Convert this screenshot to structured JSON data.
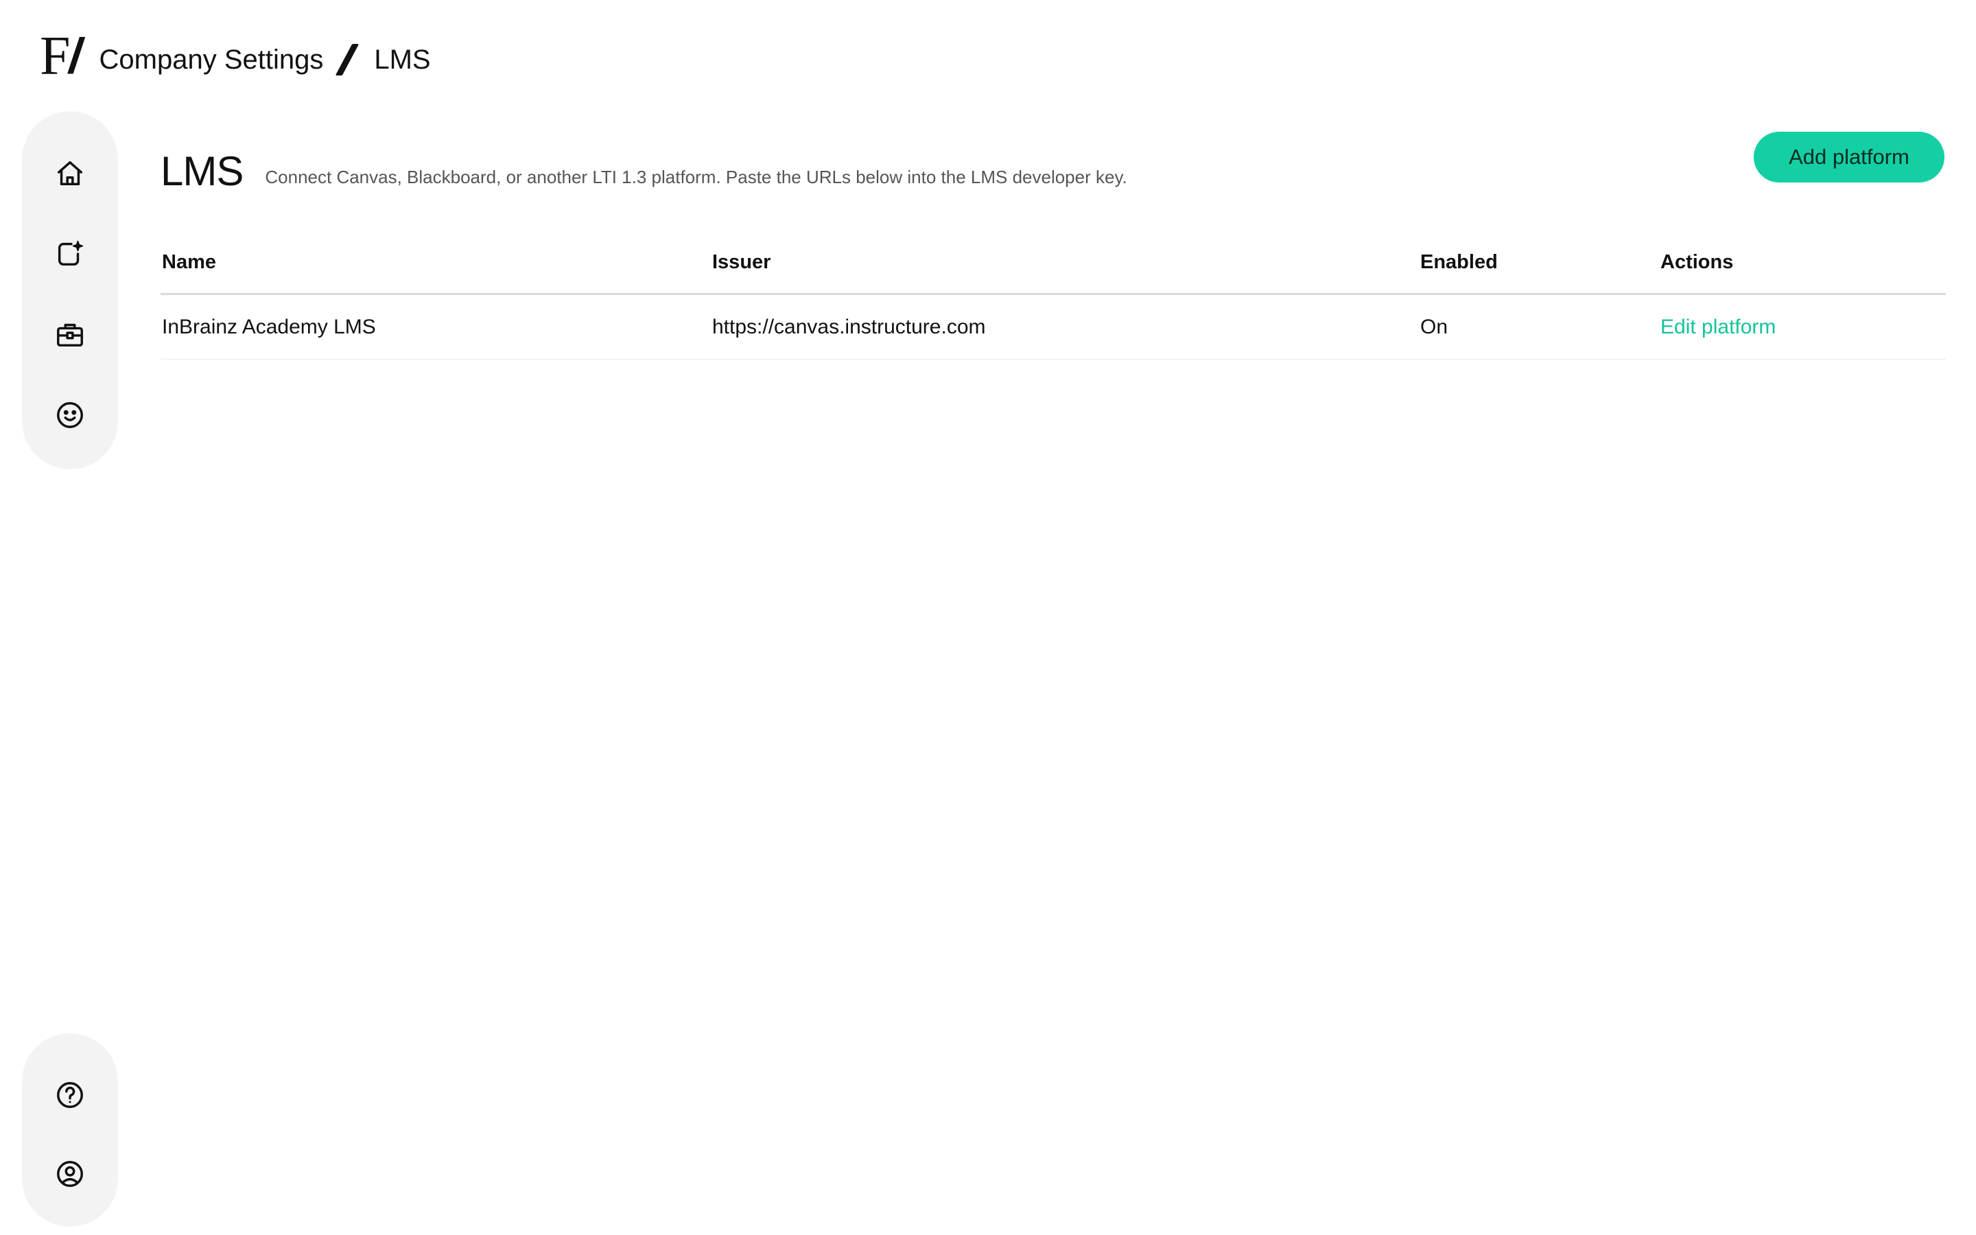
{
  "brand": {
    "logo_letter": "F",
    "logo_slash": "/"
  },
  "breadcrumb": {
    "parent": "Company Settings",
    "current": "LMS"
  },
  "sidebar": {
    "top_items": [
      {
        "icon": "home-icon"
      },
      {
        "icon": "new-item-sparkle-icon"
      },
      {
        "icon": "briefcase-icon"
      },
      {
        "icon": "smiley-icon"
      }
    ],
    "bottom_items": [
      {
        "icon": "help-icon"
      },
      {
        "icon": "account-icon"
      }
    ]
  },
  "page": {
    "title": "LMS",
    "description": "Connect Canvas, Blackboard, or another LTI 1.3 platform. Paste the URLs below into the LMS developer key.",
    "add_button_label": "Add platform"
  },
  "table": {
    "columns": [
      "Name",
      "Issuer",
      "Enabled",
      "Actions"
    ],
    "rows": [
      {
        "name": "InBrainz Academy LMS",
        "issuer": "https://canvas.instructure.com",
        "enabled": "On",
        "action": "Edit platform"
      }
    ]
  },
  "colors": {
    "accent": "#14cfa3",
    "link": "#14c39b",
    "rail_bg": "#f3f3f3"
  }
}
